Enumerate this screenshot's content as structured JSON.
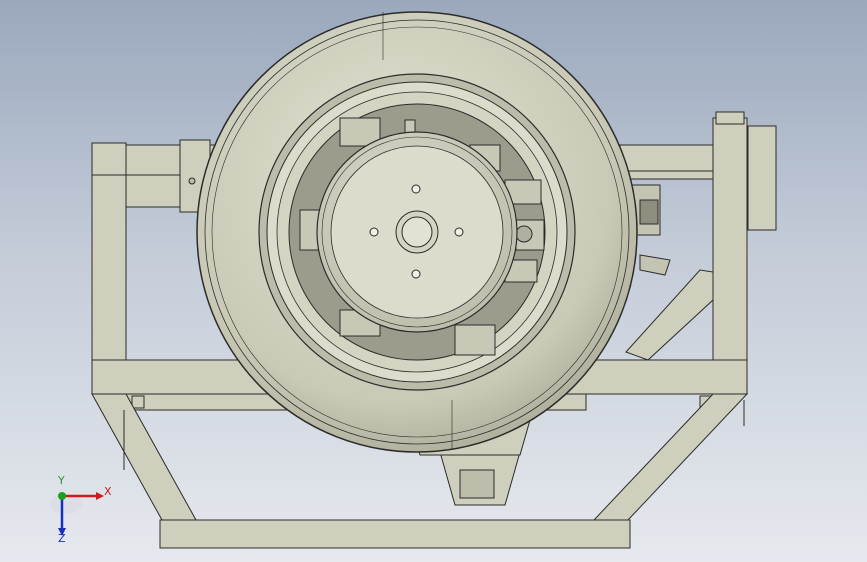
{
  "viewport": {
    "background_top": "#9aa8bd",
    "background_bottom": "#e6e9ee"
  },
  "model": {
    "part_fill": "#ccccba",
    "part_edge": "#2b2b2b",
    "tire_fill": "#d2d2c0",
    "frame_fill": "#cfcfbd"
  },
  "triad": {
    "x_label": "X",
    "y_label": "Y",
    "z_label": "Z",
    "x_color": "#d11a1a",
    "y_color": "#1aa01a",
    "z_color": "#1a2fbf"
  }
}
